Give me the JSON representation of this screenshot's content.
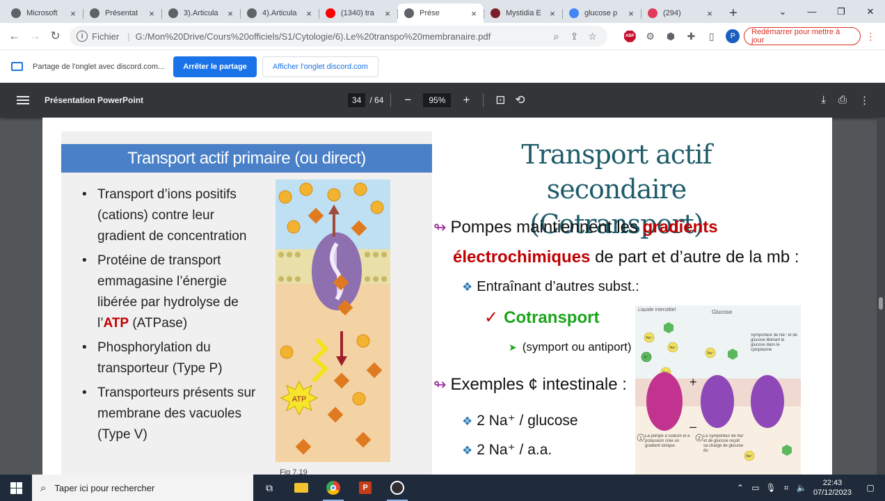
{
  "browser": {
    "tabs": [
      {
        "title": "Microsoft",
        "favicon": "globe-icon",
        "color": "#5f6368"
      },
      {
        "title": "Présentat",
        "favicon": "globe-icon",
        "color": "#5f6368"
      },
      {
        "title": "3).Articula",
        "favicon": "globe-icon",
        "color": "#5f6368"
      },
      {
        "title": "4).Articula",
        "favicon": "globe-icon",
        "color": "#5f6368"
      },
      {
        "title": "(1340) tra",
        "favicon": "youtube-icon",
        "color": "#ff0000"
      },
      {
        "title": "Prése",
        "favicon": "globe-icon",
        "color": "#5f6368",
        "active": true
      },
      {
        "title": "Mystidia E",
        "favicon": "mystidia-icon",
        "color": "#7b1f2b"
      },
      {
        "title": "glucose p",
        "favicon": "google-icon",
        "color": "#4285f4"
      },
      {
        "title": "(294)",
        "favicon": "app-icon",
        "color": "#e23a5b"
      }
    ],
    "address": {
      "scheme": "Fichier",
      "url": "G:/Mon%20Drive/Cours%20officiels/S1/Cytologie/6).Le%20transpo%20membranaire.pdf"
    },
    "profile_initial": "P",
    "relaunch_label": "Redémarrer pour mettre à jour",
    "abp_label": "ABP"
  },
  "sharebar": {
    "message": "Partage de l'onglet avec discord.com...",
    "stop_label": "Arrêter le partage",
    "show_label": "Afficher l'onglet discord.com"
  },
  "pdf": {
    "title": "Présentation PowerPoint",
    "page_current": "34",
    "page_total": "/ 64",
    "zoom": "95%"
  },
  "slide_left": {
    "header": "Transport actif primaire (ou direct)",
    "b1": "Transport d’ions positifs (cations) contre leur gradient de concentration",
    "b2_pre": "Protéine de transport emmagasine l’énergie libérée par hydrolyse de l’",
    "b2_atp": "ATP",
    "b2_post": " (ATPase)",
    "b3": "Phosphorylation du transporteur (Type P)",
    "b4": "Transporteurs présents sur membrane des vacuoles (Type V)",
    "atp_label": "ATP",
    "fig_caption": "Fig 7.19"
  },
  "slide_right": {
    "title_l1": "Transport actif secondaire",
    "title_l2": "(Cotransport)",
    "p1_a": "Pompes maintiennent les ",
    "p1_red": "gradients",
    "p1_red2": "électrochimiques",
    "p1_b": " de part et d’autre de la mb :",
    "sub1": "Entraînant d’autres subst.:",
    "cotransport": "Cotransport",
    "symport": "(symport ou antiport)",
    "examples": "Exemples ¢ intestinale :",
    "ex1": "2 Na⁺ / glucose",
    "ex2": "2 Na⁺ / a.a."
  },
  "figure": {
    "liquide": "Liquide interstitiel",
    "glucose": "Glucose",
    "symporter_note": "Symporteur de Na⁺ et de glucose libérant le glucose dans le cytoplasme",
    "step1": "La pompe à sodium et à potassium crée un gradient ionique.",
    "step2": "Le symporteur de Na⁺ et de glucose reçoit sa charge de glucose du",
    "na": "Na⁺",
    "k": "K⁺",
    "plus": "+",
    "minus": "–",
    "n1": "1",
    "n2": "2"
  },
  "taskbar": {
    "search_placeholder": "Taper ici pour rechercher",
    "time": "22:43",
    "date": "07/12/2023"
  }
}
